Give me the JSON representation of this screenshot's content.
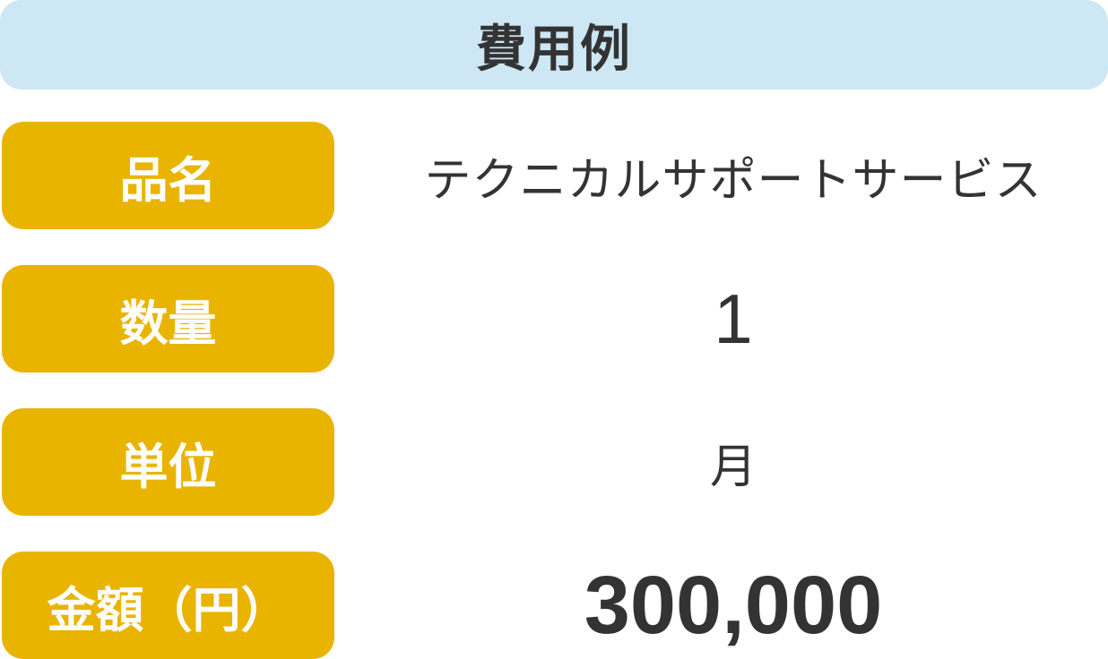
{
  "header": {
    "title": "費用例"
  },
  "rows": [
    {
      "label": "品名",
      "value": "テクニカルサポートサービス"
    },
    {
      "label": "数量",
      "value": "1"
    },
    {
      "label": "単位",
      "value": "月"
    },
    {
      "label": "金額（円）",
      "value": "300,000"
    }
  ],
  "colors": {
    "header_background": "#cde7f4",
    "label_background": "#e9b400",
    "label_text": "#ffffff",
    "value_text": "#333333"
  }
}
